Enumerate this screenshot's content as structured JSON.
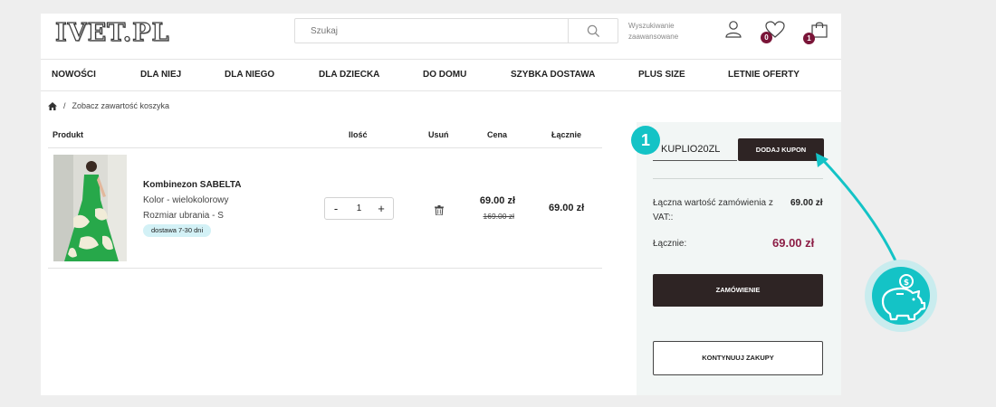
{
  "brand": {
    "logo_text": "IVET.PL",
    "accent": "#14c3c6",
    "dark": "#2e2424",
    "price_color": "#8c1d45",
    "badge_color": "#7a1538"
  },
  "header": {
    "search_placeholder": "Szukaj",
    "advanced_search": "Wyszukiwanie zaawansowane",
    "icons": {
      "account": "user-icon",
      "wishlist": "heart-icon",
      "cart": "bag-icon",
      "search": "search-icon"
    },
    "wishlist_count": "0",
    "cart_count": "1"
  },
  "nav": [
    "NOWOŚCI",
    "DLA NIEJ",
    "DLA NIEGO",
    "DLA DZIECKA",
    "DO DOMU",
    "SZYBKA DOSTAWA",
    "PLUS SIZE",
    "LETNIE OFERTY"
  ],
  "breadcrumb": {
    "home_icon": "home-icon",
    "separator": "/",
    "current": "Zobacz zawartość koszyka"
  },
  "cart_table": {
    "headers": {
      "product": "Produkt",
      "quantity": "Ilość",
      "remove": "Usuń",
      "price": "Cena",
      "total": "Łącznie"
    },
    "items": [
      {
        "name": "Kombinezon SABELTA",
        "color": "Kolor - wielokolorowy",
        "size": "Rozmiar ubrania - S",
        "delivery": "dostawa 7-30 dni",
        "qty_minus": "-",
        "quantity": "1",
        "qty_plus": "+",
        "price": "69.00 zł",
        "old_price": "169.00 zł",
        "total": "69.00 zł"
      }
    ]
  },
  "summary": {
    "coupon_value": "KUPLIO20ZL",
    "coupon_button": "DODAJ KUPON",
    "order_value_label": "Łączna wartość zamówienia z VAT::",
    "order_value": "69.00 zł",
    "total_label": "Łącznie:",
    "total": "69.00 zł",
    "order_button": "ZAMÓWIENIE",
    "continue_button": "KONTYNUUJ ZAKUPY"
  },
  "annotation": {
    "step": "1",
    "badge_icon": "piggy-bank-icon"
  }
}
